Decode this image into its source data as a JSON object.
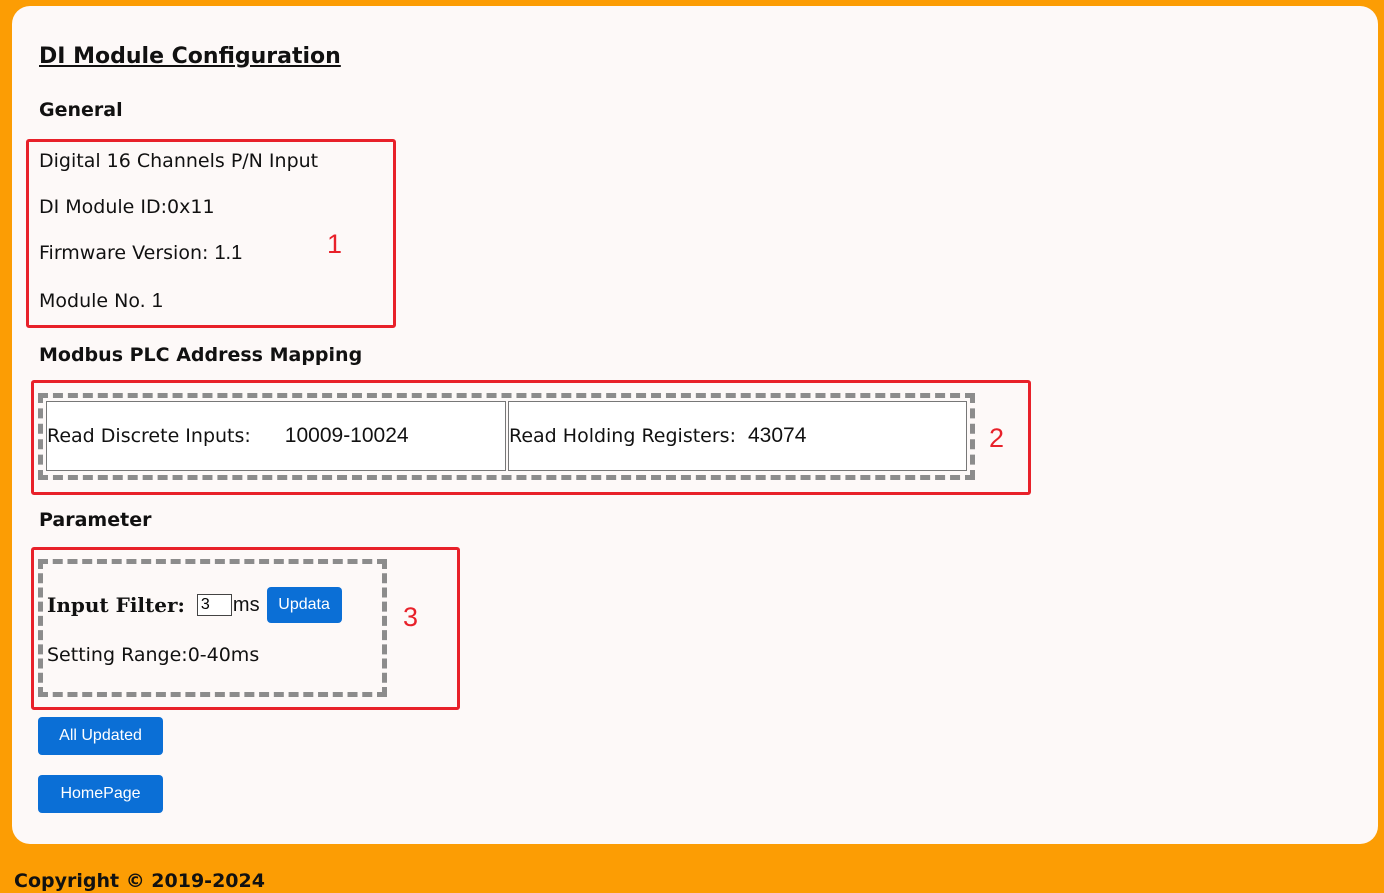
{
  "page": {
    "title": "DI Module Configuration"
  },
  "general": {
    "heading": "General",
    "channels": "Digital 16 Channels P/N Input",
    "module_id_label": "DI Module ID:",
    "module_id_value": "0x11",
    "firmware_label": "Firmware Version: ",
    "firmware_value": "1.1",
    "module_no_label": "Module No. ",
    "module_no_value": "1"
  },
  "mapping": {
    "heading": "Modbus PLC Address Mapping",
    "discrete_label": "Read Discrete Inputs:",
    "discrete_value": "10009-10024",
    "holding_label": "Read Holding Registers:",
    "holding_value": "43074"
  },
  "parameter": {
    "heading": "Parameter",
    "filter_label": "Input Filter:",
    "filter_value": "3",
    "filter_unit": "ms",
    "update_button": "Updata",
    "setting_range": "Setting Range:0-40ms"
  },
  "actions": {
    "all_updated": "All Updated",
    "homepage": "HomePage"
  },
  "annotations": [
    "1",
    "2",
    "3"
  ],
  "footer": {
    "copyright": "Copyright © 2019-2024"
  },
  "colors": {
    "frame": "#fc9d04",
    "panel": "#fdf9f8",
    "annotation_red": "#e8212a",
    "button_blue": "#0b6fd6"
  }
}
